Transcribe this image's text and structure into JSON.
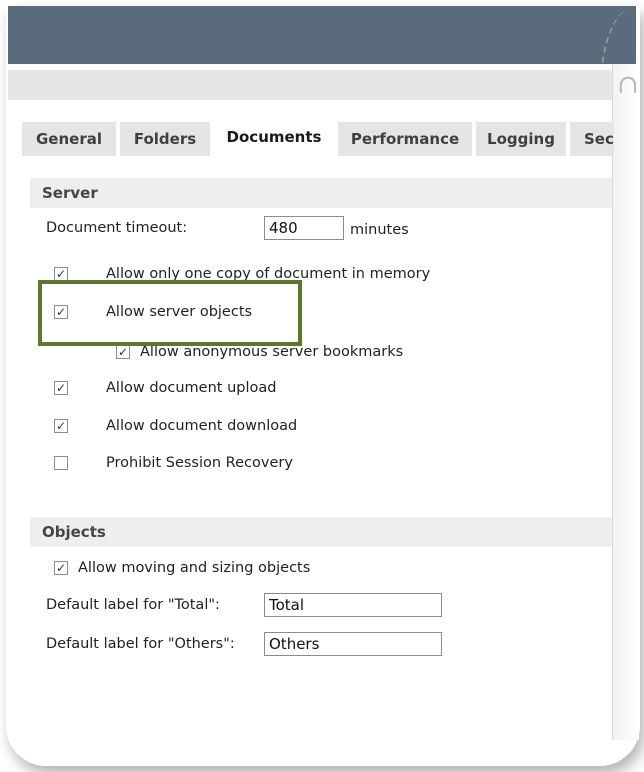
{
  "tabs": [
    "General",
    "Folders",
    "Documents",
    "Performance",
    "Logging",
    "Sec"
  ],
  "active_tab": "Documents",
  "server": {
    "title": "Server",
    "doc_timeout_label": "Document timeout:",
    "doc_timeout_value": "480",
    "doc_timeout_unit": "minutes",
    "options": [
      {
        "label": "Allow only one copy of document in memory",
        "checked": true
      },
      {
        "label": "Allow server objects",
        "checked": true
      },
      {
        "label": "Allow anonymous server bookmarks",
        "checked": true
      },
      {
        "label": "Allow document upload",
        "checked": true
      },
      {
        "label": "Allow document download",
        "checked": true
      },
      {
        "label": "Prohibit Session Recovery",
        "checked": false
      }
    ]
  },
  "objects": {
    "title": "Objects",
    "moving_label": "Allow moving and sizing objects",
    "moving_checked": true,
    "total_label": "Default label for \"Total\":",
    "total_value": "Total",
    "others_label": "Default label for \"Others\":",
    "others_value": "Others"
  },
  "colors": {
    "titlebar": "#5b6b7e",
    "highlight": "#5a7a2a"
  }
}
